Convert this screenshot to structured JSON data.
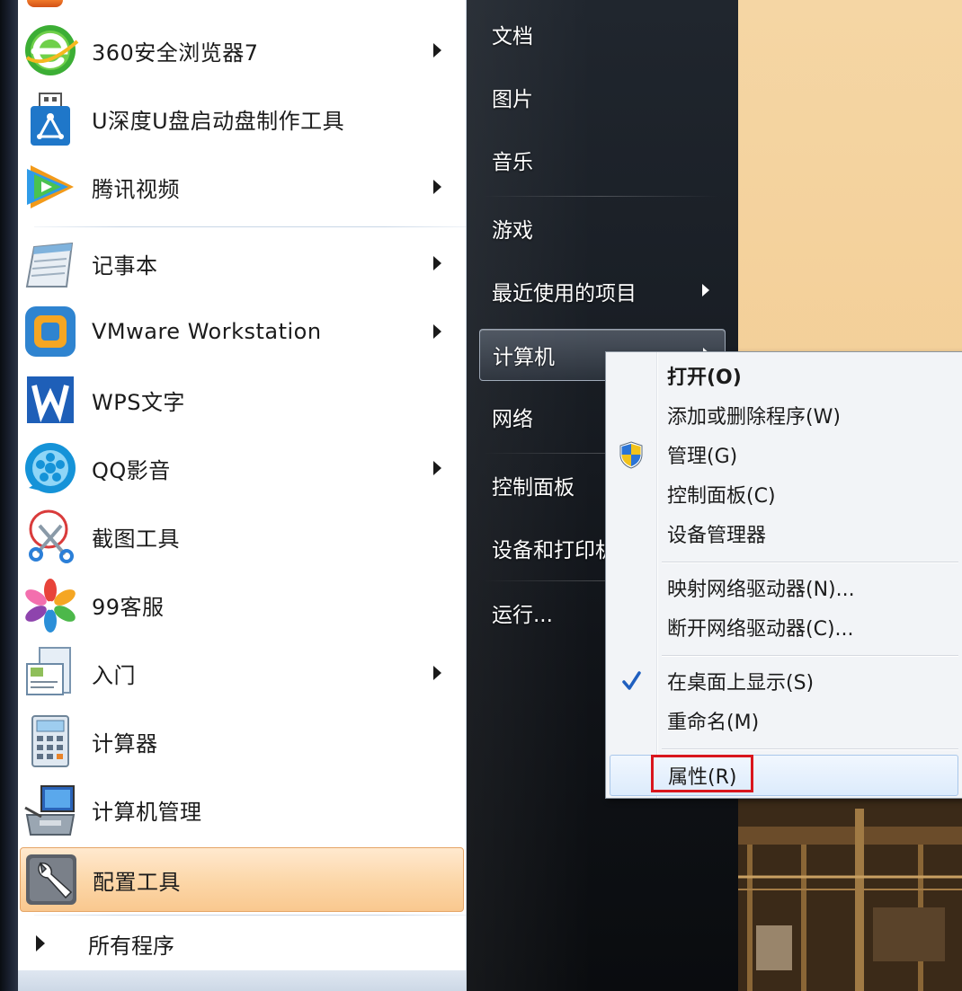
{
  "start_menu": {
    "programs": [
      {
        "label": "360安全浏览器7",
        "icon": "360-browser-icon",
        "has_submenu": true
      },
      {
        "label": "U深度U盘启动盘制作工具",
        "icon": "usb-boot-tool-icon",
        "has_submenu": false
      },
      {
        "label": "腾讯视频",
        "icon": "tencent-video-icon",
        "has_submenu": true
      },
      {
        "label": "记事本",
        "icon": "notepad-icon",
        "has_submenu": true
      },
      {
        "label": "VMware Workstation",
        "icon": "vmware-icon",
        "has_submenu": true
      },
      {
        "label": "WPS文字",
        "icon": "wps-writer-icon",
        "has_submenu": false
      },
      {
        "label": "QQ影音",
        "icon": "qq-player-icon",
        "has_submenu": true
      },
      {
        "label": "截图工具",
        "icon": "snipping-tool-icon",
        "has_submenu": false
      },
      {
        "label": "99客服",
        "icon": "99-service-icon",
        "has_submenu": false
      },
      {
        "label": "入门",
        "icon": "getting-started-icon",
        "has_submenu": true
      },
      {
        "label": "计算器",
        "icon": "calculator-icon",
        "has_submenu": false
      },
      {
        "label": "计算机管理",
        "icon": "computer-management-icon",
        "has_submenu": false
      },
      {
        "label": "配置工具",
        "icon": "config-tool-icon",
        "has_submenu": false,
        "highlighted": true
      }
    ],
    "all_programs_label": "所有程序",
    "right_items": [
      {
        "label": "文档"
      },
      {
        "label": "图片"
      },
      {
        "label": "音乐"
      },
      {
        "label": "游戏"
      },
      {
        "label": "最近使用的项目",
        "has_submenu": true
      },
      {
        "label": "计算机",
        "has_submenu": true,
        "selected": true
      },
      {
        "label": "网络"
      },
      {
        "label": "控制面板"
      },
      {
        "label": "设备和打印机"
      },
      {
        "label": "运行..."
      }
    ]
  },
  "context_menu": {
    "items": [
      {
        "label": "打开(O)",
        "bold": true
      },
      {
        "label": "添加或删除程序(W)"
      },
      {
        "label": "管理(G)",
        "icon": "uac-shield-icon"
      },
      {
        "label": "控制面板(C)"
      },
      {
        "label": "设备管理器"
      },
      {
        "label": "映射网络驱动器(N)..."
      },
      {
        "label": "断开网络驱动器(C)..."
      },
      {
        "label": "在桌面上显示(S)",
        "checked": true
      },
      {
        "label": "重命名(M)"
      },
      {
        "label": "属性(R)",
        "hover": true,
        "annotated": true
      }
    ]
  },
  "colors": {
    "highlight_orange": "#f9c88f",
    "menu_hover_blue": "#dcebfc",
    "annotation_red": "#d9161d",
    "check_blue": "#1f5fbf"
  }
}
